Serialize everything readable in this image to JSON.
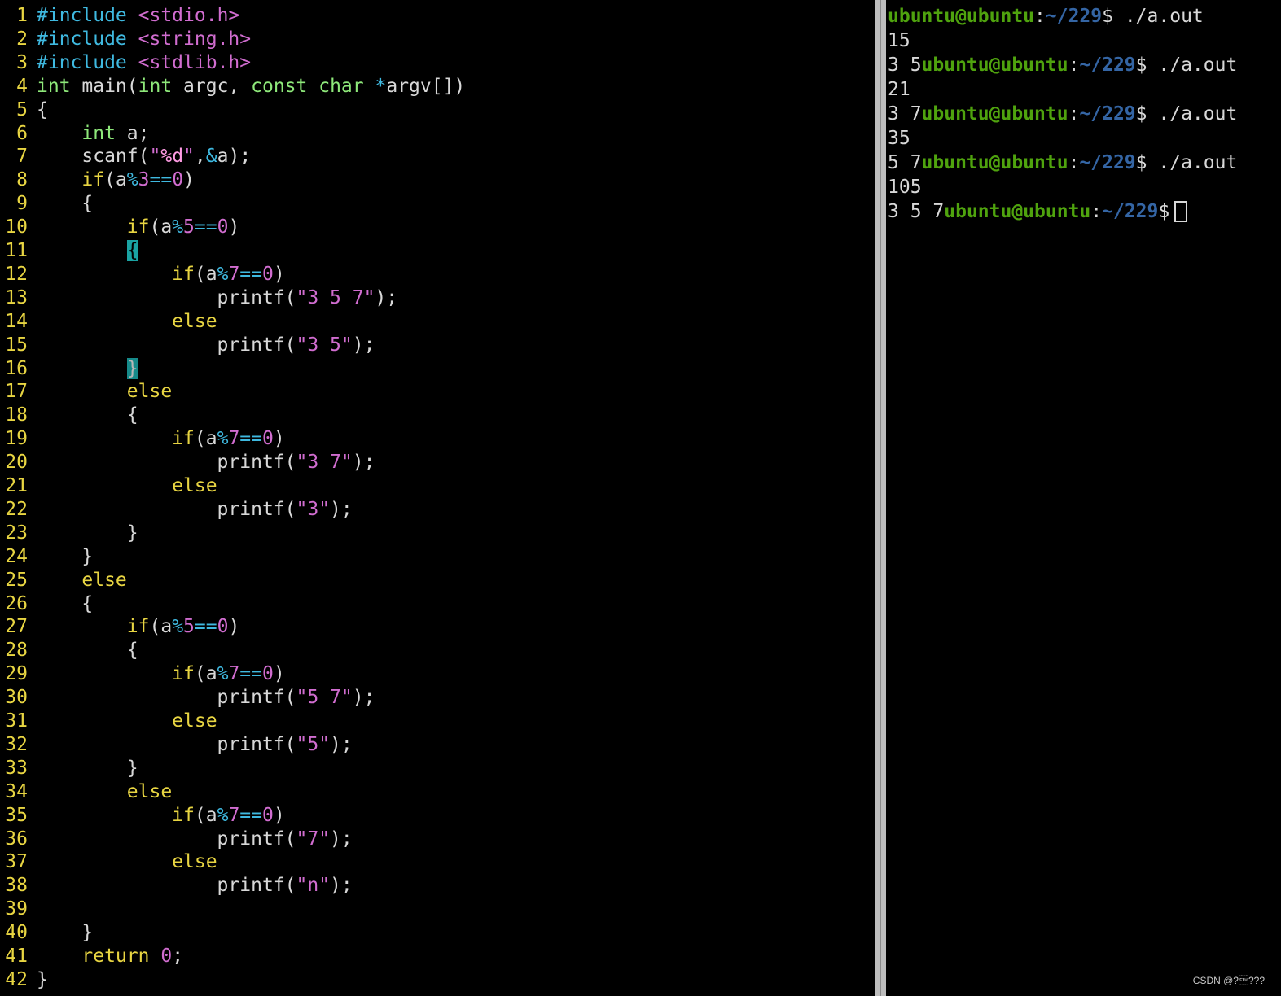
{
  "colors": {
    "line_number": "#e8d542",
    "preprocessor": "#3fb9e0",
    "type": "#8ee87a",
    "keyword": "#e8d542",
    "constant": "#d16dd0",
    "terminal_user": "#4fa30e",
    "terminal_path": "#3465a4",
    "top_border": "#c4161c"
  },
  "editor": {
    "lines": [
      {
        "n": "1",
        "tokens": [
          [
            "#include",
            "pp"
          ],
          [
            " ",
            "tx"
          ],
          [
            "<stdio.h>",
            "inc"
          ]
        ]
      },
      {
        "n": "2",
        "tokens": [
          [
            "#include",
            "pp"
          ],
          [
            " ",
            "tx"
          ],
          [
            "<string.h>",
            "inc"
          ]
        ]
      },
      {
        "n": "3",
        "tokens": [
          [
            "#include",
            "pp"
          ],
          [
            " ",
            "tx"
          ],
          [
            "<stdlib.h>",
            "inc"
          ]
        ]
      },
      {
        "n": "4",
        "tokens": [
          [
            "int",
            "ty"
          ],
          [
            " main(",
            "tx"
          ],
          [
            "int",
            "ty"
          ],
          [
            " argc, ",
            "tx"
          ],
          [
            "const",
            "ty"
          ],
          [
            " ",
            "tx"
          ],
          [
            "char",
            "ty"
          ],
          [
            " ",
            "tx"
          ],
          [
            "*",
            "op"
          ],
          [
            "argv[])",
            "tx"
          ]
        ]
      },
      {
        "n": "5",
        "tokens": [
          [
            "{",
            "tx"
          ]
        ]
      },
      {
        "n": "6",
        "tokens": [
          [
            "    ",
            "tx"
          ],
          [
            "int",
            "ty"
          ],
          [
            " a;",
            "tx"
          ]
        ]
      },
      {
        "n": "7",
        "tokens": [
          [
            "    scanf(",
            "tx"
          ],
          [
            "\"",
            "st"
          ],
          [
            "%d",
            "fm"
          ],
          [
            "\"",
            "st"
          ],
          [
            ",",
            "tx"
          ],
          [
            "&",
            "op"
          ],
          [
            "a);",
            "tx"
          ]
        ]
      },
      {
        "n": "8",
        "tokens": [
          [
            "    ",
            "tx"
          ],
          [
            "if",
            "kw"
          ],
          [
            "(a",
            "tx"
          ],
          [
            "%",
            "op"
          ],
          [
            "3",
            "nm"
          ],
          [
            "==",
            "op"
          ],
          [
            "0",
            "nm"
          ],
          [
            ")",
            "tx"
          ]
        ]
      },
      {
        "n": "9",
        "tokens": [
          [
            "    {",
            "tx"
          ]
        ]
      },
      {
        "n": "10",
        "tokens": [
          [
            "        ",
            "tx"
          ],
          [
            "if",
            "kw"
          ],
          [
            "(a",
            "tx"
          ],
          [
            "%",
            "op"
          ],
          [
            "5",
            "nm"
          ],
          [
            "==",
            "op"
          ],
          [
            "0",
            "nm"
          ],
          [
            ")",
            "tx"
          ]
        ]
      },
      {
        "n": "11",
        "tokens": [
          [
            "        ",
            "tx"
          ],
          [
            "{",
            "mb"
          ]
        ]
      },
      {
        "n": "12",
        "tokens": [
          [
            "            ",
            "tx"
          ],
          [
            "if",
            "kw"
          ],
          [
            "(a",
            "tx"
          ],
          [
            "%",
            "op"
          ],
          [
            "7",
            "nm"
          ],
          [
            "==",
            "op"
          ],
          [
            "0",
            "nm"
          ],
          [
            ")",
            "tx"
          ]
        ]
      },
      {
        "n": "13",
        "tokens": [
          [
            "                printf(",
            "tx"
          ],
          [
            "\"3 5 7\"",
            "st"
          ],
          [
            ");",
            "tx"
          ]
        ]
      },
      {
        "n": "14",
        "tokens": [
          [
            "            ",
            "tx"
          ],
          [
            "else",
            "kw"
          ]
        ]
      },
      {
        "n": "15",
        "tokens": [
          [
            "                printf(",
            "tx"
          ],
          [
            "\"3 5\"",
            "st"
          ],
          [
            ");",
            "tx"
          ]
        ]
      },
      {
        "n": "16",
        "tokens": [
          [
            "        ",
            "tx"
          ],
          [
            "}",
            "mb2"
          ]
        ]
      },
      {
        "n": "17",
        "tokens": [
          [
            "        ",
            "tx"
          ],
          [
            "else",
            "kw"
          ]
        ]
      },
      {
        "n": "18",
        "tokens": [
          [
            "        {",
            "tx"
          ]
        ]
      },
      {
        "n": "19",
        "tokens": [
          [
            "            ",
            "tx"
          ],
          [
            "if",
            "kw"
          ],
          [
            "(a",
            "tx"
          ],
          [
            "%",
            "op"
          ],
          [
            "7",
            "nm"
          ],
          [
            "==",
            "op"
          ],
          [
            "0",
            "nm"
          ],
          [
            ")",
            "tx"
          ]
        ]
      },
      {
        "n": "20",
        "tokens": [
          [
            "                printf(",
            "tx"
          ],
          [
            "\"3 7\"",
            "st"
          ],
          [
            ");",
            "tx"
          ]
        ]
      },
      {
        "n": "21",
        "tokens": [
          [
            "            ",
            "tx"
          ],
          [
            "else",
            "kw"
          ]
        ]
      },
      {
        "n": "22",
        "tokens": [
          [
            "                printf(",
            "tx"
          ],
          [
            "\"3\"",
            "st"
          ],
          [
            ");",
            "tx"
          ]
        ]
      },
      {
        "n": "23",
        "tokens": [
          [
            "        }",
            "tx"
          ]
        ]
      },
      {
        "n": "24",
        "tokens": [
          [
            "    }",
            "tx"
          ]
        ]
      },
      {
        "n": "25",
        "tokens": [
          [
            "    ",
            "tx"
          ],
          [
            "else",
            "kw"
          ]
        ]
      },
      {
        "n": "26",
        "tokens": [
          [
            "    {",
            "tx"
          ]
        ]
      },
      {
        "n": "27",
        "tokens": [
          [
            "        ",
            "tx"
          ],
          [
            "if",
            "kw"
          ],
          [
            "(a",
            "tx"
          ],
          [
            "%",
            "op"
          ],
          [
            "5",
            "nm"
          ],
          [
            "==",
            "op"
          ],
          [
            "0",
            "nm"
          ],
          [
            ")",
            "tx"
          ]
        ]
      },
      {
        "n": "28",
        "tokens": [
          [
            "        {",
            "tx"
          ]
        ]
      },
      {
        "n": "29",
        "tokens": [
          [
            "            ",
            "tx"
          ],
          [
            "if",
            "kw"
          ],
          [
            "(a",
            "tx"
          ],
          [
            "%",
            "op"
          ],
          [
            "7",
            "nm"
          ],
          [
            "==",
            "op"
          ],
          [
            "0",
            "nm"
          ],
          [
            ")",
            "tx"
          ]
        ]
      },
      {
        "n": "30",
        "tokens": [
          [
            "                printf(",
            "tx"
          ],
          [
            "\"5 7\"",
            "st"
          ],
          [
            ");",
            "tx"
          ]
        ]
      },
      {
        "n": "31",
        "tokens": [
          [
            "            ",
            "tx"
          ],
          [
            "else",
            "kw"
          ]
        ]
      },
      {
        "n": "32",
        "tokens": [
          [
            "                printf(",
            "tx"
          ],
          [
            "\"5\"",
            "st"
          ],
          [
            ");",
            "tx"
          ]
        ]
      },
      {
        "n": "33",
        "tokens": [
          [
            "        }",
            "tx"
          ]
        ]
      },
      {
        "n": "34",
        "tokens": [
          [
            "        ",
            "tx"
          ],
          [
            "else",
            "kw"
          ]
        ]
      },
      {
        "n": "35",
        "tokens": [
          [
            "            ",
            "tx"
          ],
          [
            "if",
            "kw"
          ],
          [
            "(a",
            "tx"
          ],
          [
            "%",
            "op"
          ],
          [
            "7",
            "nm"
          ],
          [
            "==",
            "op"
          ],
          [
            "0",
            "nm"
          ],
          [
            ")",
            "tx"
          ]
        ]
      },
      {
        "n": "36",
        "tokens": [
          [
            "                printf(",
            "tx"
          ],
          [
            "\"7\"",
            "st"
          ],
          [
            ");",
            "tx"
          ]
        ]
      },
      {
        "n": "37",
        "tokens": [
          [
            "            ",
            "tx"
          ],
          [
            "else",
            "kw"
          ]
        ]
      },
      {
        "n": "38",
        "tokens": [
          [
            "                printf(",
            "tx"
          ],
          [
            "\"n\"",
            "st"
          ],
          [
            ");",
            "tx"
          ]
        ]
      },
      {
        "n": "39",
        "tokens": []
      },
      {
        "n": "40",
        "tokens": [
          [
            "    }",
            "tx"
          ]
        ]
      },
      {
        "n": "41",
        "tokens": [
          [
            "    ",
            "tx"
          ],
          [
            "return",
            "kw"
          ],
          [
            " ",
            "tx"
          ],
          [
            "0",
            "nm"
          ],
          [
            ";",
            "tx"
          ]
        ]
      },
      {
        "n": "42",
        "tokens": [
          [
            "}",
            "tx"
          ]
        ]
      }
    ]
  },
  "terminal": {
    "user_host": "ubuntu@ubuntu",
    "colon": ":",
    "path": "~/229",
    "dollar": "$",
    "lines": [
      {
        "pre": "",
        "prompt": true,
        "cmd": " ./a.out"
      },
      {
        "pre": "15",
        "prompt": false,
        "cmd": ""
      },
      {
        "pre": "3 5",
        "prompt": true,
        "cmd": " ./a.out"
      },
      {
        "pre": "21",
        "prompt": false,
        "cmd": ""
      },
      {
        "pre": "3 7",
        "prompt": true,
        "cmd": " ./a.out"
      },
      {
        "pre": "35",
        "prompt": false,
        "cmd": ""
      },
      {
        "pre": "5 7",
        "prompt": true,
        "cmd": " ./a.out"
      },
      {
        "pre": "105",
        "prompt": false,
        "cmd": ""
      },
      {
        "pre": "3 5 7",
        "prompt": true,
        "cmd": "",
        "cursor": true
      }
    ]
  },
  "watermark": "CSDN @?\u0002???"
}
